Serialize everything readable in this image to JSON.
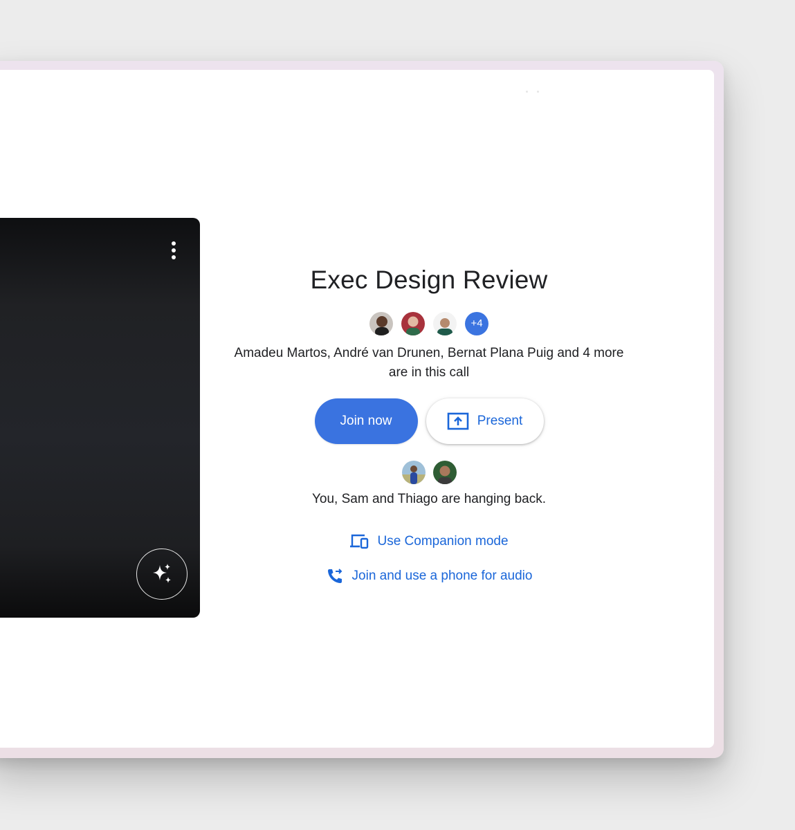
{
  "meeting": {
    "title": "Exec Design Review",
    "participants_summary": "Amadeu Martos, André van Drunen, Bernat Plana Puig and 4 more are in this call",
    "more_count": "+4"
  },
  "actions": {
    "join_label": "Join now",
    "present_label": "Present"
  },
  "hanging_back": {
    "text": "You, Sam and Thiago are hanging back."
  },
  "links": {
    "companion_label": "Use Companion mode",
    "phone_label": "Join and use a phone for audio"
  },
  "icons": {
    "more_options": "more-vert-icon",
    "effects": "sparkle-icon",
    "present": "present-screen-icon",
    "companion": "companion-devices-icon",
    "phone": "phone-forward-icon"
  },
  "colors": {
    "primary": "#3a73e0",
    "link": "#1a66d9",
    "preview_bg": "#202124"
  }
}
